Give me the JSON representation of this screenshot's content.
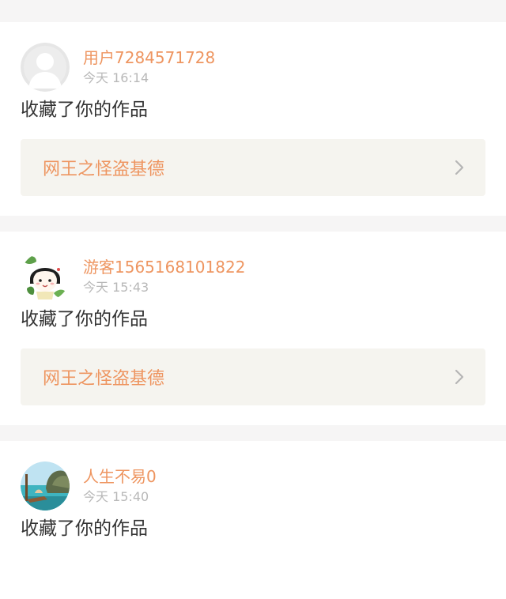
{
  "notifications": [
    {
      "username": "用户7284571728",
      "time": "今天 16:14",
      "action": "收藏了你的作品",
      "work_title": "网王之怪盗基德",
      "avatar_icon": "default-user-avatar"
    },
    {
      "username": "游客1565168101822",
      "time": "今天 15:43",
      "action": "收藏了你的作品",
      "work_title": "网王之怪盗基德",
      "avatar_icon": "cartoon-girl-avatar"
    },
    {
      "username": "人生不易0",
      "time": "今天 15:40",
      "action": "收藏了你的作品",
      "avatar_icon": "beach-photo-avatar"
    }
  ],
  "colors": {
    "accent": "#ee9560",
    "time": "#b8b8b8",
    "text": "#333333",
    "card_bg": "#ffffff",
    "page_bg": "#f6f5f5",
    "link_bg": "#f5f4ef"
  }
}
